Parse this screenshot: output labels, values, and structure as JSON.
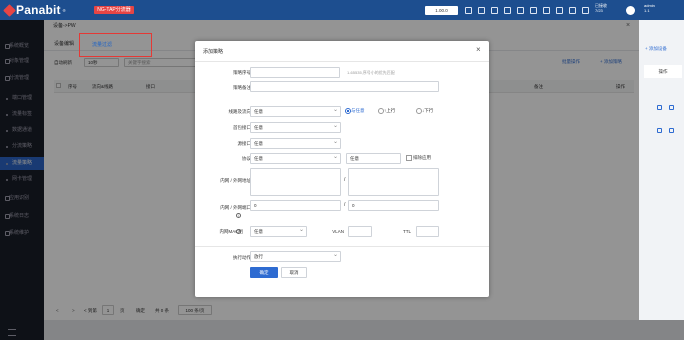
{
  "app": {
    "logo_text": "Panabit",
    "logo_sup": "®",
    "badge": "NG-TAP分流器",
    "top_pill": "1.00.0",
    "stats": [
      "已接收",
      "7/23"
    ],
    "user": [
      "admin",
      "1.1"
    ]
  },
  "sidebar": {
    "items": [
      {
        "label": "系统概览",
        "type": "main"
      },
      {
        "label": "对象管理",
        "type": "main"
      },
      {
        "label": "分流管理",
        "type": "main"
      },
      {
        "label": "端口管理",
        "type": "sub"
      },
      {
        "label": "流量标签",
        "type": "sub"
      },
      {
        "label": "数据通道",
        "type": "sub"
      },
      {
        "label": "分流策略",
        "type": "sub"
      },
      {
        "label": "流量策略",
        "type": "sub",
        "active": true
      },
      {
        "label": "网卡管理",
        "type": "sub"
      },
      {
        "label": "应用识别",
        "type": "main"
      },
      {
        "label": "系统日志",
        "type": "main"
      },
      {
        "label": "系统维护",
        "type": "main"
      }
    ]
  },
  "window": {
    "title": "设备->PW",
    "close": "×",
    "tabs": [
      "设备编辑",
      "流量过滤"
    ],
    "filter": {
      "auto_refresh_label": "自动刷新",
      "interval": "10秒",
      "search_placeholder": "关键字搜索"
    },
    "actions": {
      "batch": "批量操作",
      "add": "+ 添加策略"
    },
    "grid_headers": [
      "序号",
      "流向&线路",
      "接口",
      "备注",
      "操作"
    ],
    "pager": {
      "first": "< 到第",
      "page": "1",
      "page_unit": "页",
      "confirm": "确定",
      "total": "共 0 条",
      "page_size": "100 条/页"
    }
  },
  "right_pane": {
    "add": "+ 添加设备",
    "header": "操作"
  },
  "dialog": {
    "title": "添加策略",
    "close": "×",
    "policy_no_label": "策略序号",
    "policy_no_hint": "1-65535,序号小的优先匹配",
    "policy_note_label": "策略备注",
    "line_dir_label": "线路及流向",
    "line_dir_value": "任意",
    "dir_options": [
      "与任意",
      "↑上行",
      "↓下行"
    ],
    "dir_selected": 0,
    "first_iface_label": "首包接口",
    "first_iface_value": "任意",
    "src_iface_label": "源接口",
    "src_iface_value": "任意",
    "proto_label": "协议",
    "proto_value": "任意",
    "proto_right": "任意",
    "exclude_app": "排除应用",
    "ip_label": "内网 / 外网地址",
    "port_label": "内网 / 外网端口",
    "port_in": "0",
    "port_out": "0",
    "mac_label": "内网MAC组",
    "mac_value": "任意",
    "vlan_label": "VLAN",
    "ttl_label": "TTL",
    "action_label": "执行动作",
    "action_value": "放行",
    "confirm": "确定",
    "cancel": "取消",
    "slash": "/"
  }
}
